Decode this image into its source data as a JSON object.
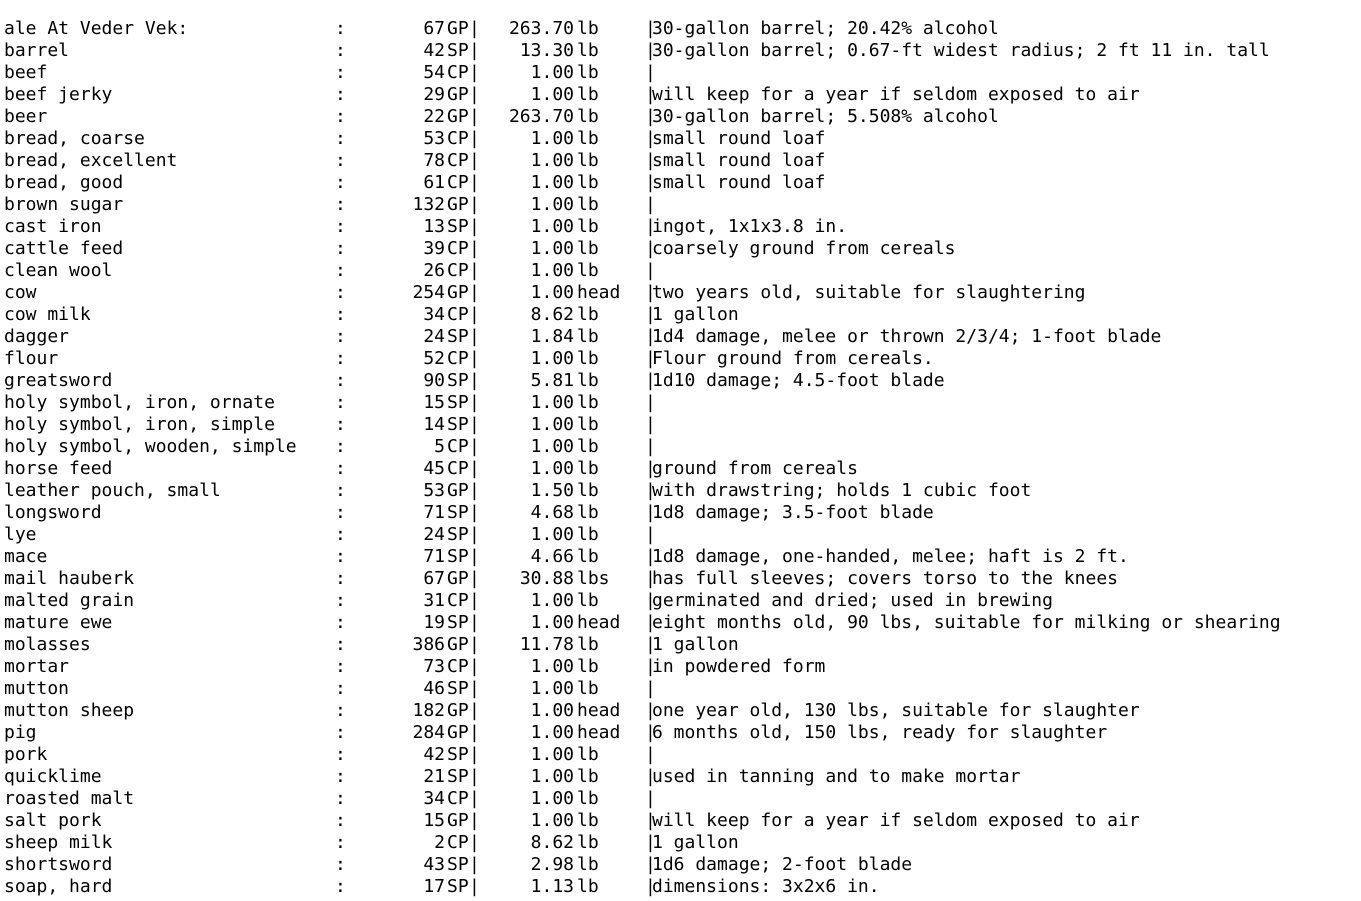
{
  "terminal": {
    "title": "At Veder Vek:",
    "separator": ":",
    "bar": "|",
    "selection_color": "#b4d5fe"
  },
  "rows": [
    {
      "name": "ale",
      "price": "67",
      "unit": "GP",
      "weight": "263.70",
      "weight_unit": "lb",
      "note": "30-gallon barrel; 20.42% alcohol"
    },
    {
      "name": "barrel",
      "price": "42",
      "unit": "SP",
      "weight": "13.30",
      "weight_unit": "lb",
      "note": "30-gallon barrel; 0.67-ft widest radius; 2 ft 11 in. tall"
    },
    {
      "name": "beef",
      "price": "54",
      "unit": "CP",
      "weight": "1.00",
      "weight_unit": "lb",
      "note": ""
    },
    {
      "name": "beef jerky",
      "price": "29",
      "unit": "GP",
      "weight": "1.00",
      "weight_unit": "lb",
      "note": "will keep for a year if seldom exposed to air"
    },
    {
      "name": "beer",
      "price": "22",
      "unit": "GP",
      "weight": "263.70",
      "weight_unit": "lb",
      "note": "30-gallon barrel; 5.508% alcohol"
    },
    {
      "name": "bread, coarse",
      "price": "53",
      "unit": "CP",
      "weight": "1.00",
      "weight_unit": "lb",
      "note": "small round loaf"
    },
    {
      "name": "bread, excellent",
      "price": "78",
      "unit": "CP",
      "weight": "1.00",
      "weight_unit": "lb",
      "note": "small round loaf"
    },
    {
      "name": "bread, good",
      "price": "61",
      "unit": "CP",
      "weight": "1.00",
      "weight_unit": "lb",
      "note": "small round loaf"
    },
    {
      "name": "brown sugar",
      "price": "132",
      "unit": "GP",
      "weight": "1.00",
      "weight_unit": "lb",
      "note": ""
    },
    {
      "name": "cast iron",
      "price": "13",
      "unit": "SP",
      "weight": "1.00",
      "weight_unit": "lb",
      "note": "ingot, 1x1x3.8 in."
    },
    {
      "name": "cattle feed",
      "price": "39",
      "unit": "CP",
      "weight": "1.00",
      "weight_unit": "lb",
      "note": "coarsely ground from cereals"
    },
    {
      "name": "clean wool",
      "price": "26",
      "unit": "CP",
      "weight": "1.00",
      "weight_unit": "lb",
      "note": ""
    },
    {
      "name": "cow",
      "price": "254",
      "unit": "GP",
      "weight": "1.00",
      "weight_unit": "head",
      "note": "two years old, suitable for slaughtering"
    },
    {
      "name": "cow milk",
      "price": "34",
      "unit": "CP",
      "weight": "8.62",
      "weight_unit": "lb",
      "note": "1 gallon"
    },
    {
      "name": "dagger",
      "price": "24",
      "unit": "SP",
      "weight": "1.84",
      "weight_unit": "lb",
      "note": "1d4 damage, melee or thrown 2/3/4; 1-foot blade"
    },
    {
      "name": "flour",
      "price": "52",
      "unit": "CP",
      "weight": "1.00",
      "weight_unit": "lb",
      "note": "Flour ground from cereals."
    },
    {
      "name": "greatsword",
      "price": "90",
      "unit": "SP",
      "weight": "5.81",
      "weight_unit": "lb",
      "note": "1d10 damage; 4.5-foot blade"
    },
    {
      "name": "holy symbol, iron, ornate",
      "price": "15",
      "unit": "SP",
      "weight": "1.00",
      "weight_unit": "lb",
      "note": ""
    },
    {
      "name": "holy symbol, iron, simple",
      "price": "14",
      "unit": "SP",
      "weight": "1.00",
      "weight_unit": "lb",
      "note": "",
      "selected": true
    },
    {
      "name": "holy symbol, wooden, simple",
      "price": "5",
      "unit": "CP",
      "weight": "1.00",
      "weight_unit": "lb",
      "note": ""
    },
    {
      "name": "horse feed",
      "price": "45",
      "unit": "CP",
      "weight": "1.00",
      "weight_unit": "lb",
      "note": "ground from cereals"
    },
    {
      "name": "leather pouch, small",
      "price": "53",
      "unit": "GP",
      "weight": "1.50",
      "weight_unit": "lb",
      "note": "with drawstring; holds 1 cubic foot"
    },
    {
      "name": "longsword",
      "price": "71",
      "unit": "SP",
      "weight": "4.68",
      "weight_unit": "lb",
      "note": "1d8 damage; 3.5-foot blade"
    },
    {
      "name": "lye",
      "price": "24",
      "unit": "SP",
      "weight": "1.00",
      "weight_unit": "lb",
      "note": ""
    },
    {
      "name": "mace",
      "price": "71",
      "unit": "SP",
      "weight": "4.66",
      "weight_unit": "lb",
      "note": "1d8 damage, one-handed, melee; haft is 2 ft."
    },
    {
      "name": "mail hauberk",
      "price": "67",
      "unit": "GP",
      "weight": "30.88",
      "weight_unit": "lbs",
      "note": "has full sleeves; covers torso to the knees"
    },
    {
      "name": "malted grain",
      "price": "31",
      "unit": "CP",
      "weight": "1.00",
      "weight_unit": "lb",
      "note": "germinated and dried; used in brewing"
    },
    {
      "name": "mature ewe",
      "price": "19",
      "unit": "SP",
      "weight": "1.00",
      "weight_unit": "head",
      "note": "eight months old, 90 lbs, suitable for milking or shearing"
    },
    {
      "name": "molasses",
      "price": "386",
      "unit": "GP",
      "weight": "11.78",
      "weight_unit": "lb",
      "note": "1 gallon"
    },
    {
      "name": "mortar",
      "price": "73",
      "unit": "CP",
      "weight": "1.00",
      "weight_unit": "lb",
      "note": "in powdered form"
    },
    {
      "name": "mutton",
      "price": "46",
      "unit": "SP",
      "weight": "1.00",
      "weight_unit": "lb",
      "note": ""
    },
    {
      "name": "mutton sheep",
      "price": "182",
      "unit": "GP",
      "weight": "1.00",
      "weight_unit": "head",
      "note": "one year old, 130 lbs, suitable for slaughter"
    },
    {
      "name": "pig",
      "price": "284",
      "unit": "GP",
      "weight": "1.00",
      "weight_unit": "head",
      "note": "6 months old, 150 lbs, ready for slaughter"
    },
    {
      "name": "pork",
      "price": "42",
      "unit": "SP",
      "weight": "1.00",
      "weight_unit": "lb",
      "note": ""
    },
    {
      "name": "quicklime",
      "price": "21",
      "unit": "SP",
      "weight": "1.00",
      "weight_unit": "lb",
      "note": "used in tanning and to make mortar"
    },
    {
      "name": "roasted malt",
      "price": "34",
      "unit": "CP",
      "weight": "1.00",
      "weight_unit": "lb",
      "note": ""
    },
    {
      "name": "salt pork",
      "price": "15",
      "unit": "GP",
      "weight": "1.00",
      "weight_unit": "lb",
      "note": "will keep for a year if seldom exposed to air"
    },
    {
      "name": "sheep milk",
      "price": "2",
      "unit": "CP",
      "weight": "8.62",
      "weight_unit": "lb",
      "note": "1 gallon"
    },
    {
      "name": "shortsword",
      "price": "43",
      "unit": "SP",
      "weight": "2.98",
      "weight_unit": "lb",
      "note": "1d6 damage; 2-foot blade"
    },
    {
      "name": "soap, hard",
      "price": "17",
      "unit": "SP",
      "weight": "1.13",
      "weight_unit": "lb",
      "note": "dimensions: 3x2x6 in."
    }
  ]
}
